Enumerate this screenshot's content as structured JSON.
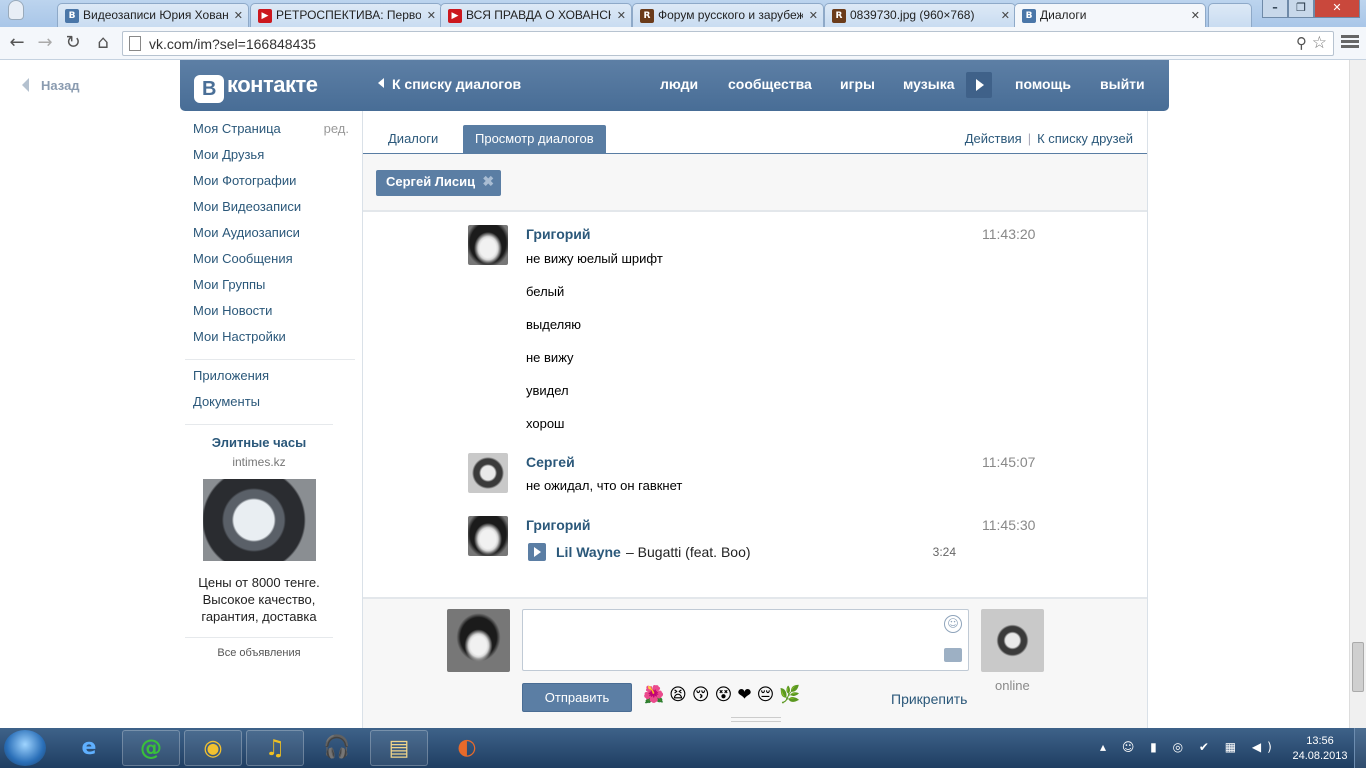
{
  "browser": {
    "tabs": [
      {
        "title": "Видеозаписи Юрия Хованского",
        "fav": "В",
        "fav_color": "#4a76a8"
      },
      {
        "title": "РЕТРОСПЕКТИВА: Первое",
        "fav": "▶",
        "fav_color": "#cc181e"
      },
      {
        "title": "ВСЯ ПРАВДА О ХОВАНСКОМ",
        "fav": "▶",
        "fav_color": "#cc181e"
      },
      {
        "title": "Форум русского и зарубежного",
        "fav": "R",
        "fav_color": "#6b3b1a"
      },
      {
        "title": "0839730.jpg (960×768)",
        "fav": "R",
        "fav_color": "#6b3b1a"
      },
      {
        "title": "Диалоги",
        "fav": "В",
        "fav_color": "#4a76a8"
      }
    ],
    "url": "vk.com/im?sel=166848435",
    "window_controls": [
      "–",
      "❐",
      "✕"
    ]
  },
  "vk": {
    "back_label": "Назад",
    "logo_letter": "В",
    "logo_text": "контакте",
    "header_back": "К списку диалогов",
    "nav": [
      "люди",
      "сообщества",
      "игры",
      "музыка",
      "помощь",
      "выйти"
    ],
    "menu": [
      {
        "label": "Моя Страница",
        "edit": "ред."
      },
      {
        "label": "Мои Друзья"
      },
      {
        "label": "Мои Фотографии"
      },
      {
        "label": "Мои Видеозаписи"
      },
      {
        "label": "Мои Аудиозаписи"
      },
      {
        "label": "Мои Сообщения"
      },
      {
        "label": "Мои Группы"
      },
      {
        "label": "Мои Новости"
      },
      {
        "label": "Мои Настройки"
      }
    ],
    "menu2": [
      "Приложения",
      "Документы"
    ],
    "ad": {
      "title": "Элитные часы",
      "domain": "intimes.kz",
      "text1": "Цены от 8000 тенге.",
      "text2": "Высокое качество,",
      "text3": "гарантия, доставка",
      "all": "Все объявления"
    },
    "tabs": {
      "dialogs": "Диалоги",
      "view": "Просмотр диалогов",
      "actions": "Действия",
      "friends": "К списку друзей",
      "separator": "|"
    },
    "chip": {
      "name": "Сергей Лисиц",
      "close": "✖"
    },
    "messages": [
      {
        "author": "Григорий",
        "time": "11:43:20",
        "lines": [
          "не вижу юелый шрифт",
          "белый",
          "выделяю",
          "не вижу",
          "увидел",
          "хорош"
        ]
      },
      {
        "author": "Сергей",
        "time": "11:45:07",
        "lines": [
          "не ожидал, что он гавкнет"
        ]
      },
      {
        "author": "Григорий",
        "time": "11:45:30",
        "audio": {
          "artist": "Lil Wayne",
          "track": "– Bugatti (feat. Boo)",
          "duration": "3:24"
        }
      }
    ],
    "composer": {
      "send": "Отправить",
      "attach": "Прикрепить",
      "online": "online",
      "emojis": "🌺😫😚😵❤😔🌿"
    }
  },
  "taskbar": {
    "apps": [
      "e",
      "@",
      "◉",
      "♫",
      "🎧",
      "▤",
      "◐"
    ],
    "tray": "▴ ☺ ▮ ◎ ✔ ▦ ◀)",
    "time": "13:56",
    "date": "24.08.2013"
  }
}
